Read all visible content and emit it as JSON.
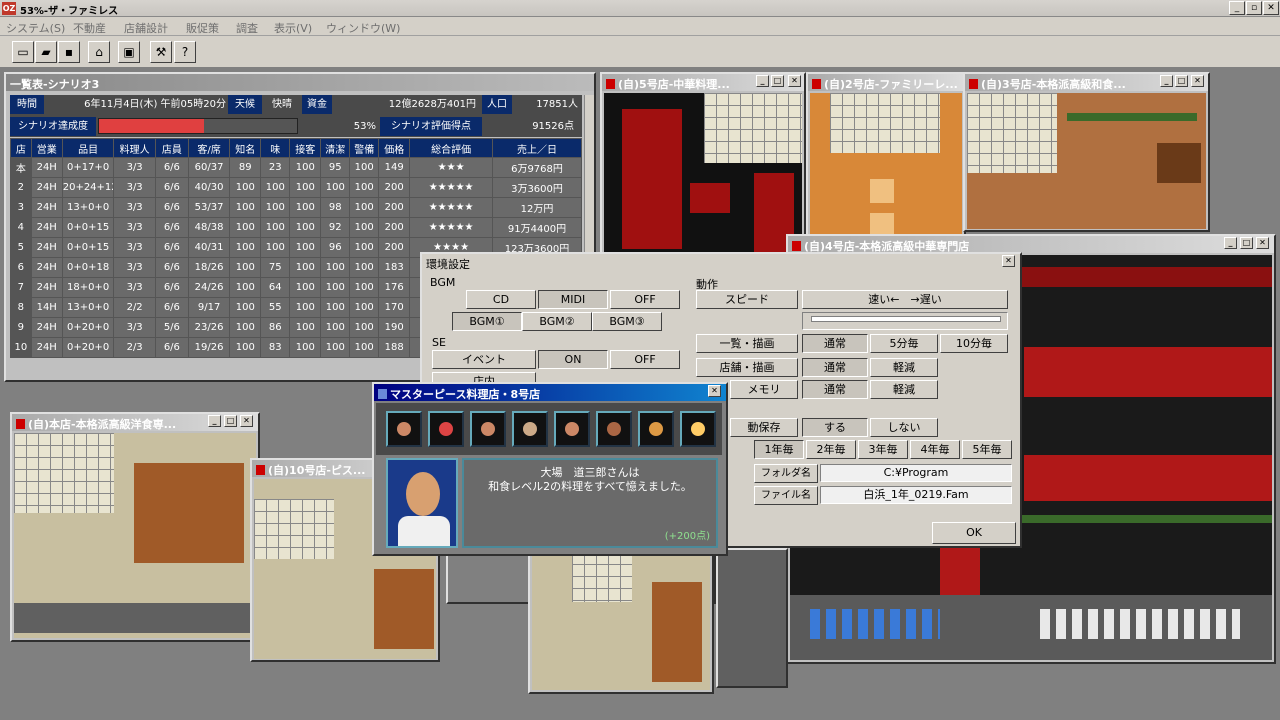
{
  "app": {
    "title": "53%-ザ・ファミレス",
    "icon": "OZ"
  },
  "menu": [
    "システム(S)",
    "不動産",
    "店舗設計",
    "販促策",
    "調査",
    "表示(V)",
    "ウィンドウ(W)"
  ],
  "toolbar": [
    "new-icon",
    "open-icon",
    "save-icon",
    "shop-icon",
    "settings-icon",
    "tools-icon",
    "help-icon"
  ],
  "list_window": {
    "title": "一覧表-シナリオ3",
    "time_label": "時間",
    "time": "6年11月4日(木) 午前05時20分",
    "weather_label": "天候",
    "weather": "快晴",
    "funds_label": "資金",
    "funds": "12億2628万401円",
    "pop_label": "人口",
    "pop": "17851人",
    "achieve_label": "シナリオ達成度",
    "achieve_pct": "53%",
    "achieve_value": 0.53,
    "score_label": "シナリオ評価得点",
    "score": "91526点",
    "headers": [
      "店",
      "営業",
      "品目",
      "料理人",
      "店員",
      "客/席",
      "知名",
      "味",
      "接客",
      "清潔",
      "警備",
      "価格",
      "総合評価",
      "売上／日"
    ],
    "rows": [
      [
        "本",
        "24H",
        "0+17+0",
        "3/3",
        "6/6",
        "60/37",
        "89",
        "23",
        "100",
        "95",
        "100",
        "149",
        "★★★",
        "6万9768円"
      ],
      [
        "2",
        "24H",
        "20+24+12",
        "3/3",
        "6/6",
        "40/30",
        "100",
        "100",
        "100",
        "100",
        "100",
        "200",
        "★★★★★",
        "3万3600円"
      ],
      [
        "3",
        "24H",
        "13+0+0",
        "3/3",
        "6/6",
        "53/37",
        "100",
        "100",
        "100",
        "98",
        "100",
        "200",
        "★★★★★",
        "12万円"
      ],
      [
        "4",
        "24H",
        "0+0+15",
        "3/3",
        "6/6",
        "48/38",
        "100",
        "100",
        "100",
        "92",
        "100",
        "200",
        "★★★★★",
        "91万4400円"
      ],
      [
        "5",
        "24H",
        "0+0+15",
        "3/3",
        "6/6",
        "40/31",
        "100",
        "100",
        "100",
        "96",
        "100",
        "200",
        "★★★★",
        "123万3600円"
      ],
      [
        "6",
        "24H",
        "0+0+18",
        "3/3",
        "6/6",
        "18/26",
        "100",
        "75",
        "100",
        "100",
        "100",
        "183",
        "",
        ""
      ],
      [
        "7",
        "24H",
        "18+0+0",
        "3/3",
        "6/6",
        "24/26",
        "100",
        "64",
        "100",
        "100",
        "100",
        "176",
        "",
        ""
      ],
      [
        "8",
        "14H",
        "13+0+0",
        "2/2",
        "6/6",
        "9/17",
        "100",
        "55",
        "100",
        "100",
        "100",
        "170",
        "",
        ""
      ],
      [
        "9",
        "24H",
        "0+20+0",
        "3/3",
        "5/6",
        "23/26",
        "100",
        "86",
        "100",
        "100",
        "100",
        "190",
        "★",
        ""
      ],
      [
        "10",
        "24H",
        "0+20+0",
        "2/3",
        "6/6",
        "19/26",
        "100",
        "83",
        "100",
        "100",
        "100",
        "188",
        "★",
        ""
      ]
    ]
  },
  "store_windows": [
    {
      "title": "(自)5号店-中華料理..."
    },
    {
      "title": "(自)2号店-ファミリーレ..."
    },
    {
      "title": "(自)3号店-本格派高級和食..."
    },
    {
      "title": "(自)4号店-本格派高級中華専門店"
    },
    {
      "title": "(自)本店-本格派高級洋食専..."
    },
    {
      "title": "(自)10号店-ピス..."
    }
  ],
  "settings": {
    "title": "環境設定",
    "bgm_label": "BGM",
    "bgm_buttons": [
      "CD",
      "MIDI",
      "OFF"
    ],
    "bgm_tracks": [
      "BGM①",
      "BGM②",
      "BGM③"
    ],
    "se_label": "SE",
    "se_event": "イベント",
    "se_on": "ON",
    "se_off": "OFF",
    "se_shop": "店内",
    "action_label": "動作",
    "speed_label": "スピード",
    "speed_value": "速い←　→遅い",
    "list_draw": "一覧・描画",
    "shop_draw": "店舗・描画",
    "memory": "メモリ",
    "normal": "通常",
    "light": "軽減",
    "every5": "5分毎",
    "every10": "10分毎",
    "autosave": "動保存",
    "yes": "する",
    "no": "しない",
    "years": [
      "1年毎",
      "2年毎",
      "3年毎",
      "4年毎",
      "5年毎"
    ],
    "folder_label": "フォルダ名",
    "folder": "C:¥Program",
    "file_label": "ファイル名",
    "file": "白浜_1年_0219.Fam",
    "ok": "OK"
  },
  "popup": {
    "title": "マスターピース料理店・8号店",
    "message_1": "大場　道三郎さんは",
    "message_2": "和食レベル2の料理をすべて憶えました。",
    "points": "(+200点)"
  }
}
